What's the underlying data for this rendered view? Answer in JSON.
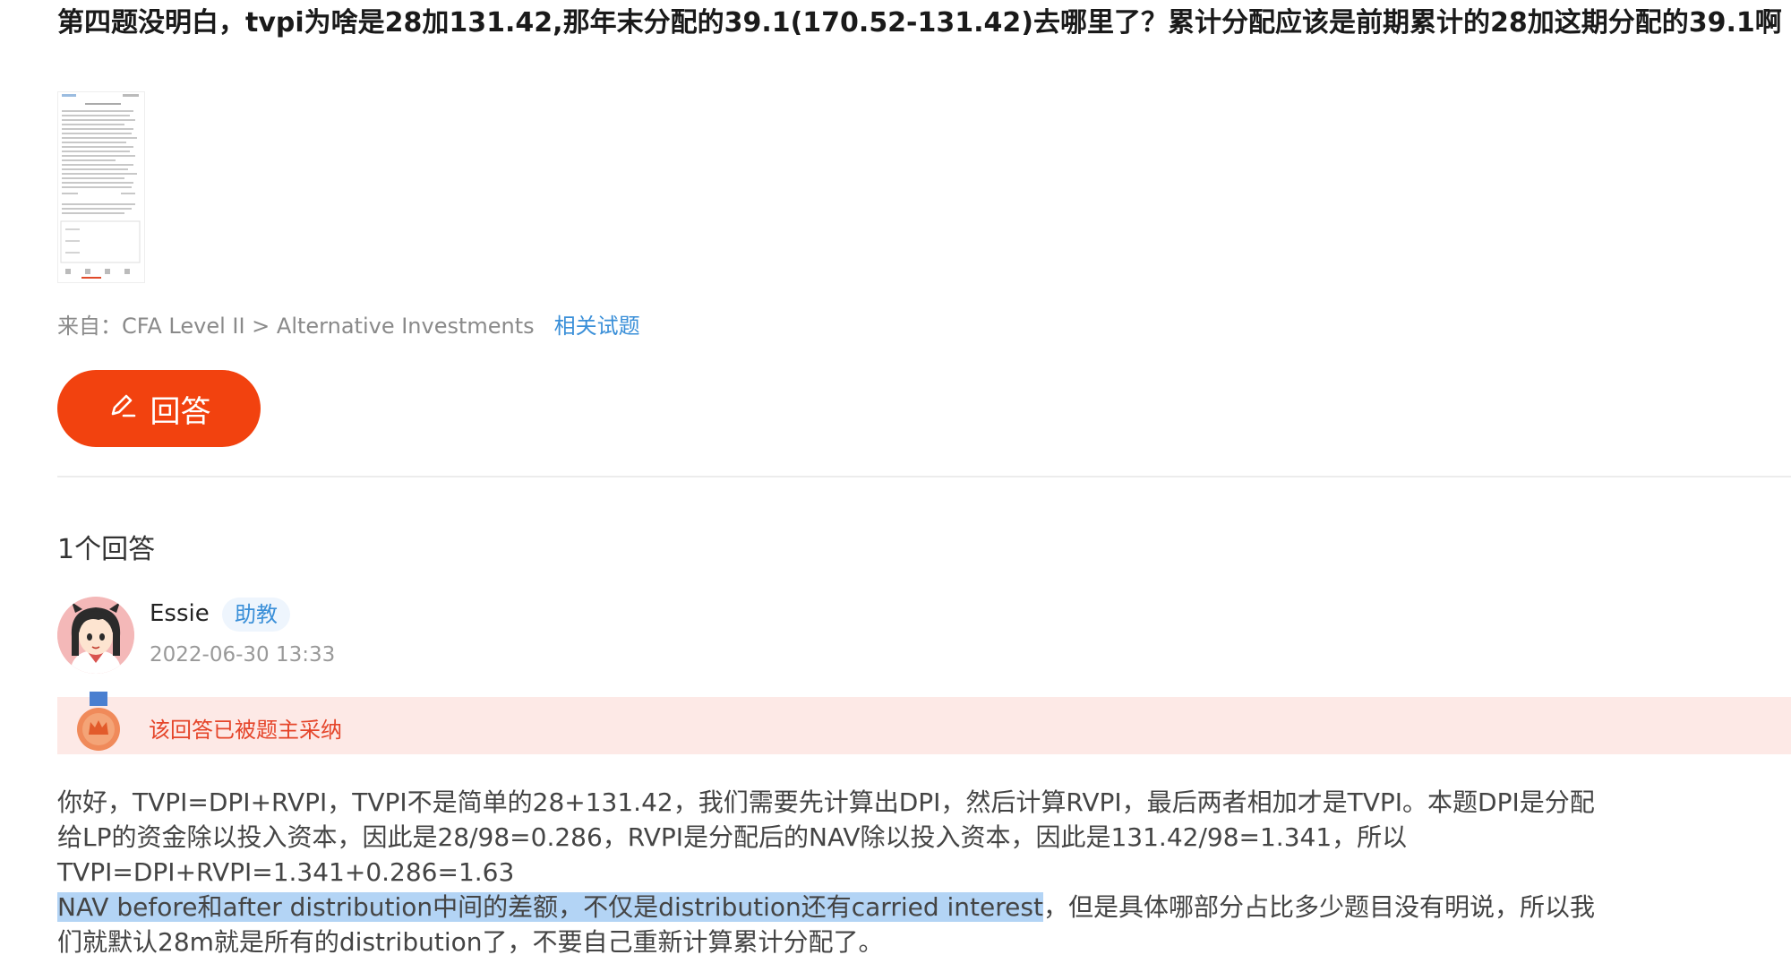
{
  "question": {
    "title": "第四题没明白，tvpi为啥是28加131.42,那年末分配的39.1(170.52-131.42)去哪里了？累计分配应该是前期累计的28加这期分配的39.1啊"
  },
  "source": {
    "label": "来自：CFA Level II > Alternative Investments",
    "related_link": "相关试题"
  },
  "answer_button": {
    "label": "回答",
    "icon": "pencil-icon"
  },
  "answers": {
    "count_label": "1个回答",
    "items": [
      {
        "author": "Essie",
        "role": "助教",
        "timestamp": "2022-06-30 13:33",
        "accepted_label": "该回答已被题主采纳",
        "para1": "你好，TVPI=DPI+RVPI，TVPI不是简单的28+131.42，我们需要先计算出DPI，然后计算RVPI，最后两者相加才是TVPI。本题DPI是分配给LP的资金除以投入资本，因此是28/98=0.286，RVPI是分配后的NAV除以投入资本，因此是131.42/98=1.341，所以TVPI=DPI+RVPI=1.341+0.286=1.63",
        "para2_highlight": "NAV before和after distribution中间的差额，不仅是distribution还有carried interest",
        "para2_rest": "，但是具体哪部分占比多少题目没有明说，所以我们就默认28m就是所有的distribution了，不要自己重新计算累计分配了。"
      }
    ]
  },
  "colors": {
    "accent": "#f2420f",
    "link": "#3a8fd8",
    "accepted_bg": "#fde9e6",
    "accepted_text": "#e5452a",
    "highlight": "#b3d4f5"
  }
}
